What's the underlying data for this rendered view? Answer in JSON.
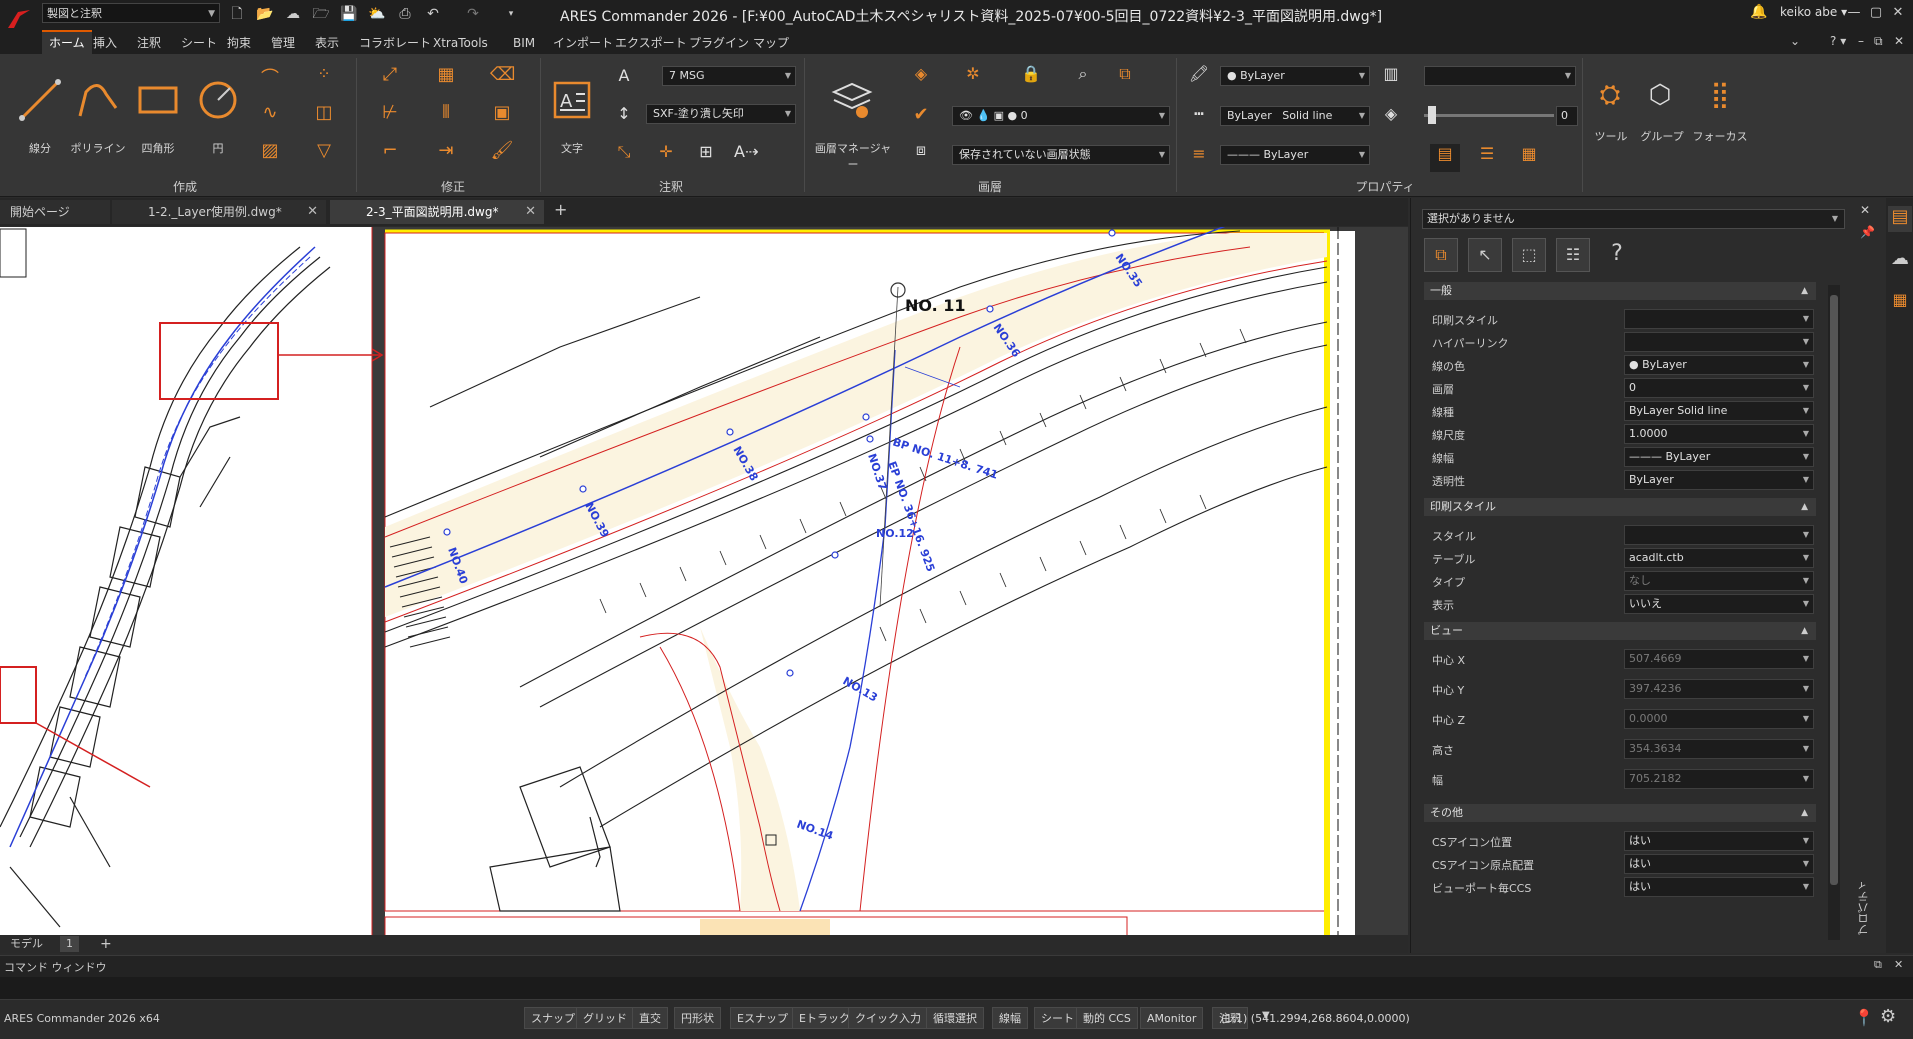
{
  "titlebar": {
    "workspace": "製図と注釈",
    "app_title": "ARES Commander 2026 - [F:¥00_AutoCAD土木スペシャリスト資料_2025-07¥00-5回目_0722資料¥2-3_平面図説明用.dwg*]",
    "user": "keiko abe",
    "help": "?"
  },
  "menu_tabs": [
    "ホーム",
    "挿入",
    "注釈",
    "シート",
    "拘束",
    "管理",
    "表示",
    "コラボレート",
    "XtraTools",
    "BIM",
    "インポート",
    "エクスポート",
    "プラグイン",
    "マップ"
  ],
  "ribbon": {
    "group_labels": {
      "create": "作成",
      "modify": "修正",
      "annotate": "注釈",
      "layer": "画層",
      "properties": "プロパティ"
    },
    "create_buttons": [
      "線分",
      "ポリライン",
      "四角形",
      "円"
    ],
    "text_style": "7 MSG",
    "leader_style": "SXF-塗り潰し矢印",
    "text_button": "文字",
    "layer_manager": "画層マネージャー",
    "layer_current": "0",
    "layer_state": "保存されていない画層状態",
    "color": "ByLayer",
    "linetype": "ByLayer",
    "linetype_name": "Solid line",
    "lineweight": "ByLayer",
    "transparency": "0",
    "tools": "ツール",
    "group": "グループ",
    "focus": "フォーカス"
  },
  "doc_tabs": [
    {
      "label": "開始ページ",
      "active": false
    },
    {
      "label": "1-2._Layer使用例.dwg*",
      "active": false
    },
    {
      "label": "2-3_平面図説明用.dwg*",
      "active": true
    }
  ],
  "drawing": {
    "station_main": "NO. 11",
    "station_labels": [
      "NO.35",
      "NO.36",
      "NO.37",
      "NO.38",
      "NO.39",
      "NO.40",
      "NO.12",
      "NO.13",
      "NO.14"
    ],
    "bp_label": "BP NO. 11+8. 741",
    "ep_label": "EP NO. 36+16. 925"
  },
  "layout_tabs": [
    "モデル",
    "1",
    "+"
  ],
  "command_window": {
    "title": "コマンド ウィンドウ"
  },
  "statusbar": {
    "app_version": "ARES Commander 2026 x64",
    "toggles": [
      "スナップ",
      "グリッド",
      "直交",
      "円形状",
      "Eスナップ",
      "Eトラック",
      "クイック入力",
      "循環選択",
      "線幅",
      "シート",
      "動的 CCS",
      "AMonitor",
      "注釈"
    ],
    "scale": "(1:1)",
    "coords": "(541.2994,268.8604,0.0000)"
  },
  "properties": {
    "selection": "選択がありません",
    "palette_title": "プロパティ",
    "sections": [
      {
        "title": "一般",
        "rows": [
          {
            "label": "印刷スタイル",
            "value": "",
            "dim": true
          },
          {
            "label": "ハイパーリンク",
            "value": "",
            "dim": false
          },
          {
            "label": "線の色",
            "value": "● ByLayer",
            "dim": false
          },
          {
            "label": "画層",
            "value": "0",
            "dim": false
          },
          {
            "label": "線種",
            "value": "ByLayer    Solid line",
            "dim": false
          },
          {
            "label": "線尺度",
            "value": "1.0000",
            "dim": false
          },
          {
            "label": "線幅",
            "value": "——— ByLayer",
            "dim": false
          },
          {
            "label": "透明性",
            "value": "ByLayer",
            "dim": false
          }
        ]
      },
      {
        "title": "印刷スタイル",
        "rows": [
          {
            "label": "スタイル",
            "value": "",
            "dim": true
          },
          {
            "label": "テーブル",
            "value": "acadlt.ctb",
            "dim": false
          },
          {
            "label": "タイプ",
            "value": "なし",
            "dim": true
          },
          {
            "label": "表示",
            "value": "いいえ",
            "dim": false
          }
        ]
      },
      {
        "title": "ビュー",
        "rows": [
          {
            "label": "中心 X",
            "value": "507.4669",
            "dim": true
          },
          {
            "label": "中心 Y",
            "value": "397.4236",
            "dim": true
          },
          {
            "label": "中心 Z",
            "value": "0.0000",
            "dim": true
          },
          {
            "label": "高さ",
            "value": "354.3634",
            "dim": true
          },
          {
            "label": "幅",
            "value": "705.2182",
            "dim": true
          }
        ]
      },
      {
        "title": "その他",
        "rows": [
          {
            "label": "CSアイコン位置",
            "value": "はい",
            "dim": false
          },
          {
            "label": "CSアイコン原点配置",
            "value": "はい",
            "dim": false
          },
          {
            "label": "ビューポート毎CCS",
            "value": "はい",
            "dim": false
          }
        ]
      }
    ]
  },
  "colors": {
    "accent": "#e05a00",
    "icon_orange": "#e98a2e",
    "station_blue": "#2a3fd6",
    "red_line": "#d42020",
    "highlight_yellow": "#ffee00"
  }
}
